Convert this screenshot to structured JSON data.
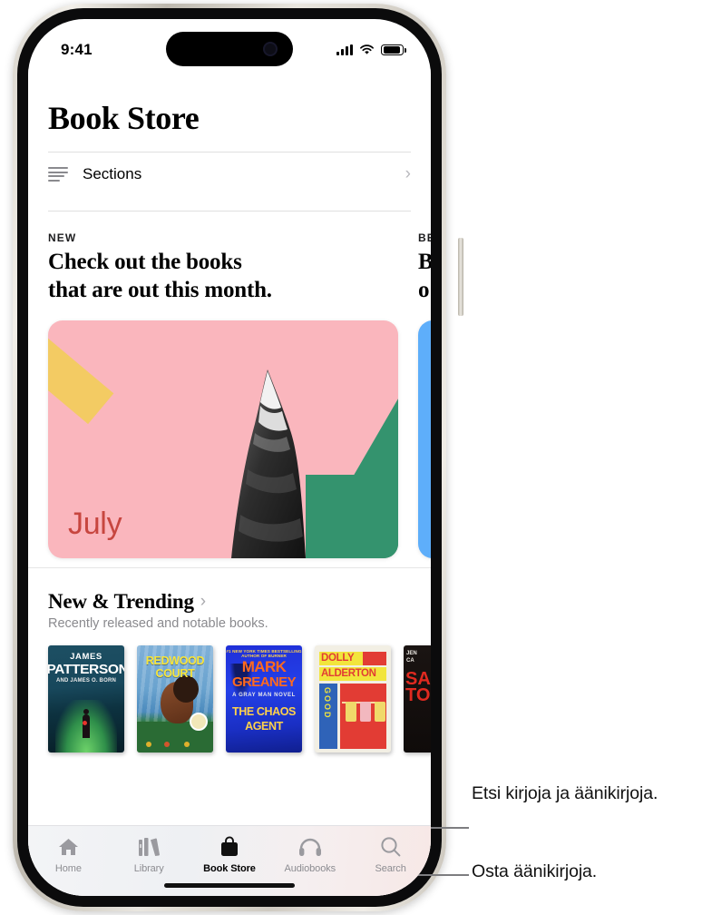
{
  "status_bar": {
    "time": "9:41",
    "icons": {
      "signal": "cellular-signal-icon",
      "wifi": "wifi-icon",
      "battery": "battery-icon"
    }
  },
  "header": {
    "title": "Book Store",
    "sections_label": "Sections",
    "chevron": "›"
  },
  "feature_cards": [
    {
      "eyebrow": "NEW",
      "headline_line1": "Check out the books",
      "headline_line2": "that are out this month.",
      "artwork_month": "July",
      "colors": {
        "background": "#fab6bd",
        "ruler": "#f3cb63",
        "peak": "#34936e",
        "month_text": "#c7463f"
      }
    },
    {
      "eyebrow": "BE",
      "headline_line1": "B",
      "headline_line2": "o",
      "artwork_month": "",
      "colors": {
        "background": "#5eaefa"
      }
    }
  ],
  "trending": {
    "title": "New & Trending",
    "chevron": "›",
    "subtitle": "Recently released and notable books.",
    "books": [
      {
        "author_line1": "JAMES",
        "author_line2": "PATTERSON",
        "author_line3": "AND JAMES O. BORN"
      },
      {
        "title_line1": "REDWOOD",
        "title_line2": "COURT"
      },
      {
        "top_line": "#1 NEW YORK TIMES BESTSELLING AUTHOR OF BURNER",
        "author_line1": "MARK",
        "author_line2": "GREANEY",
        "series": "A GRAY MAN NOVEL",
        "title_line1": "THE CHAOS",
        "title_line2": "AGENT"
      },
      {
        "author_line1": "DOLLY",
        "author_line2": "ALDERTON",
        "title_vertical": "GOOD"
      },
      {
        "author_line1": "JEN",
        "author_line2": "CA",
        "title_fragment": "SA\nHT\nTO"
      }
    ]
  },
  "tab_bar": {
    "tabs": [
      {
        "label": "Home",
        "icon": "home-icon",
        "active": false
      },
      {
        "label": "Library",
        "icon": "library-icon",
        "active": false
      },
      {
        "label": "Book Store",
        "icon": "shopping-bag-icon",
        "active": true
      },
      {
        "label": "Audiobooks",
        "icon": "headphones-icon",
        "active": false
      },
      {
        "label": "Search",
        "icon": "search-icon",
        "active": false
      }
    ]
  },
  "annotations": [
    {
      "text": "Etsi kirjoja ja äänikirjoja.",
      "points_to": "Search"
    },
    {
      "text": "Osta äänikirjoja.",
      "points_to": "Audiobooks"
    }
  ]
}
